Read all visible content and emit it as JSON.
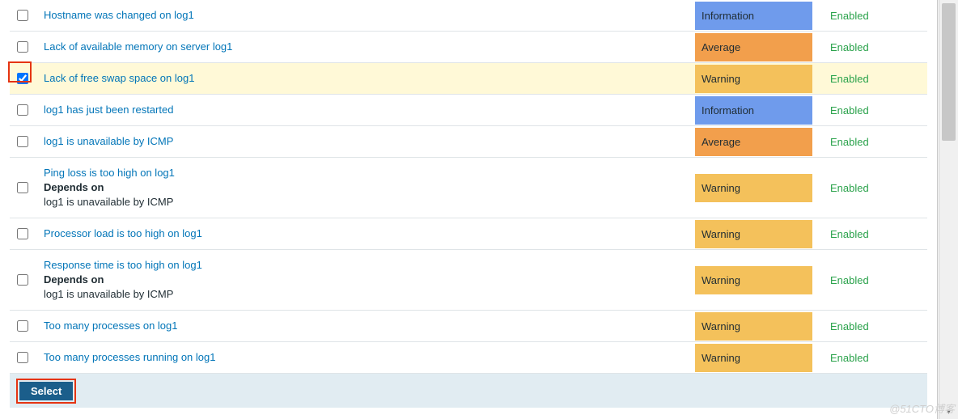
{
  "severity_colors": {
    "info": "#6f9bec",
    "avg": "#f29f4c",
    "warn": "#f4c15b"
  },
  "rows": [
    {
      "checked": false,
      "selected": false,
      "name": "Hostname was changed on log1",
      "depends_on": null,
      "severity": "Information",
      "sev_class": "sev-info",
      "status": "Enabled"
    },
    {
      "checked": false,
      "selected": false,
      "name": "Lack of available memory on server log1",
      "depends_on": null,
      "severity": "Average",
      "sev_class": "sev-avg",
      "status": "Enabled"
    },
    {
      "checked": true,
      "selected": true,
      "name": "Lack of free swap space on log1",
      "depends_on": null,
      "severity": "Warning",
      "sev_class": "sev-warn",
      "status": "Enabled"
    },
    {
      "checked": false,
      "selected": false,
      "name": "log1 has just been restarted",
      "depends_on": null,
      "severity": "Information",
      "sev_class": "sev-info",
      "status": "Enabled"
    },
    {
      "checked": false,
      "selected": false,
      "name": "log1 is unavailable by ICMP",
      "depends_on": null,
      "severity": "Average",
      "sev_class": "sev-avg",
      "status": "Enabled"
    },
    {
      "checked": false,
      "selected": false,
      "name": "Ping loss is too high on log1",
      "depends_on": "log1 is unavailable by ICMP",
      "severity": "Warning",
      "sev_class": "sev-warn",
      "status": "Enabled"
    },
    {
      "checked": false,
      "selected": false,
      "name": "Processor load is too high on log1",
      "depends_on": null,
      "severity": "Warning",
      "sev_class": "sev-warn",
      "status": "Enabled"
    },
    {
      "checked": false,
      "selected": false,
      "name": "Response time is too high on log1",
      "depends_on": "log1 is unavailable by ICMP",
      "severity": "Warning",
      "sev_class": "sev-warn",
      "status": "Enabled"
    },
    {
      "checked": false,
      "selected": false,
      "name": "Too many processes on log1",
      "depends_on": null,
      "severity": "Warning",
      "sev_class": "sev-warn",
      "status": "Enabled"
    },
    {
      "checked": false,
      "selected": false,
      "name": "Too many processes running on log1",
      "depends_on": null,
      "severity": "Warning",
      "sev_class": "sev-warn",
      "status": "Enabled"
    }
  ],
  "depends_on_label": "Depends on",
  "footer": {
    "select_label": "Select"
  },
  "watermark": "@51CTO博客"
}
